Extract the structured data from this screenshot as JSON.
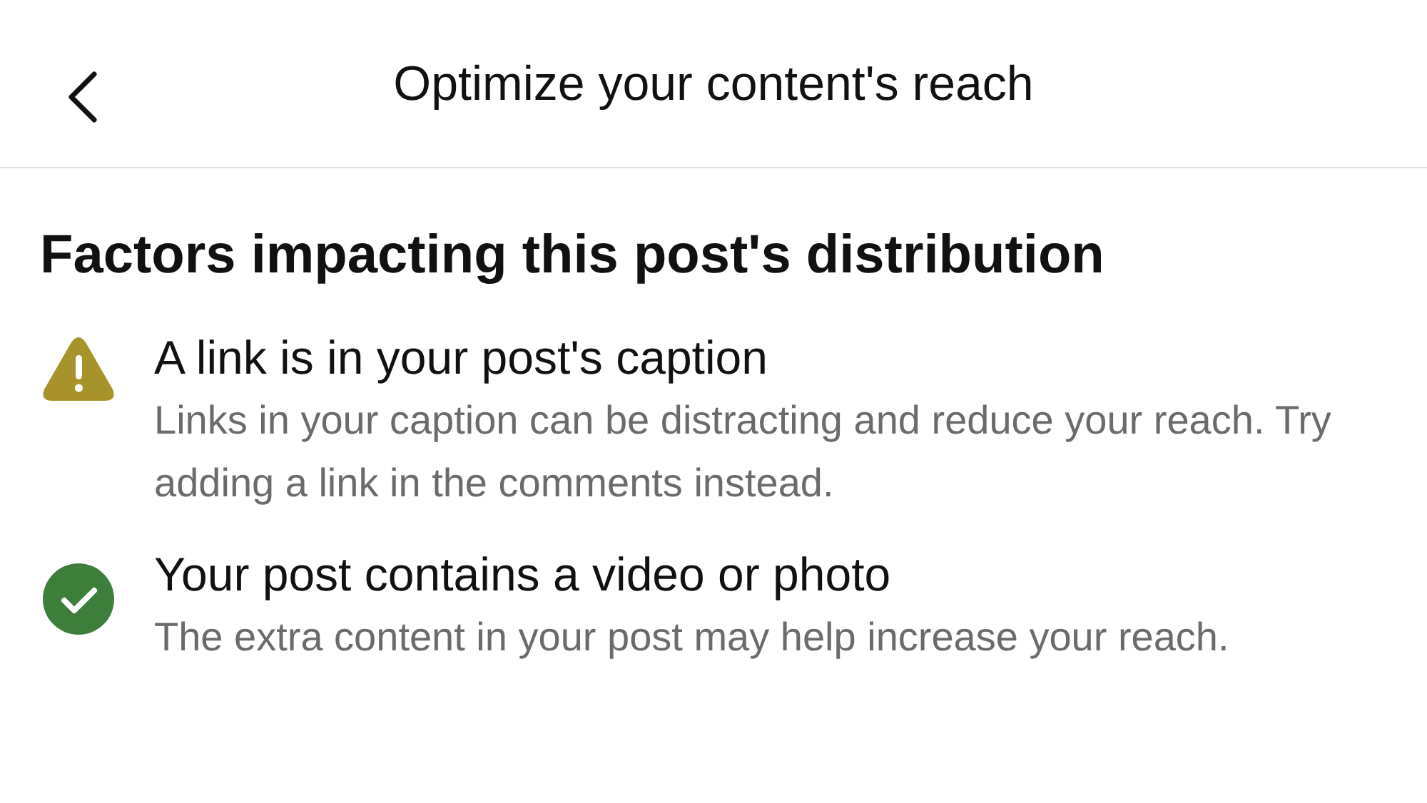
{
  "header": {
    "title": "Optimize your content's reach"
  },
  "section": {
    "heading": "Factors impacting this post's distribution",
    "factors": [
      {
        "kind": "warning",
        "title": "A link is in your post's caption",
        "description": "Links in your caption can be distracting and reduce your reach. Try adding a link in the comments instead."
      },
      {
        "kind": "ok",
        "title": "Your post contains a video or photo",
        "description": "The extra content in your post may help increase your reach."
      }
    ]
  }
}
